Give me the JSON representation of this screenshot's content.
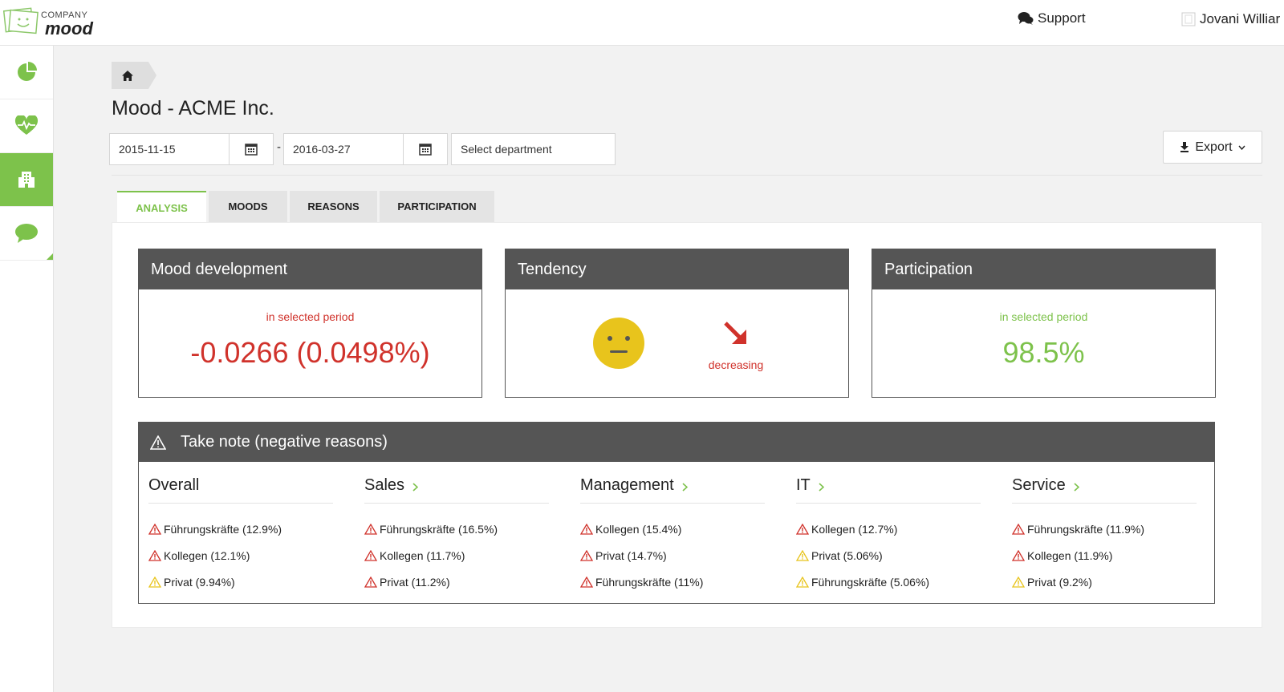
{
  "header": {
    "logo_top": "COMPANY",
    "logo_bottom": "mood",
    "support_label": "Support",
    "user_name": "Jovani Williar"
  },
  "sidebar": {
    "items": [
      {
        "name": "dashboard",
        "icon": "pie-chart-icon",
        "active": false
      },
      {
        "name": "mood",
        "icon": "heartbeat-icon",
        "active": false
      },
      {
        "name": "organization",
        "icon": "building-icon",
        "active": true
      },
      {
        "name": "comments",
        "icon": "speech-bubble-icon",
        "active": false
      }
    ]
  },
  "page": {
    "title": "Mood - ACME Inc.",
    "breadcrumb_icon": "home-icon"
  },
  "filters": {
    "start_date": "2015-11-15",
    "separator": "-",
    "end_date": "2016-03-27",
    "department_placeholder": "Select department",
    "export_label": "Export"
  },
  "tabs": [
    {
      "label": "ANALYSIS",
      "active": true
    },
    {
      "label": "MOODS",
      "active": false
    },
    {
      "label": "REASONS",
      "active": false
    },
    {
      "label": "PARTICIPATION",
      "active": false
    }
  ],
  "cards": {
    "mood_development": {
      "title": "Mood development",
      "sub": "in selected period",
      "value": "-0.0266 (0.0498%)"
    },
    "tendency": {
      "title": "Tendency",
      "label": "decreasing"
    },
    "participation": {
      "title": "Participation",
      "sub": "in selected period",
      "value": "98.5%"
    }
  },
  "take_note": {
    "title": "Take note (negative reasons)",
    "columns": [
      {
        "title": "Overall",
        "link": false,
        "reasons": [
          {
            "text": "Führungskräfte (12.9%)",
            "level": "red"
          },
          {
            "text": "Kollegen (12.1%)",
            "level": "red"
          },
          {
            "text": "Privat (9.94%)",
            "level": "yellow"
          }
        ]
      },
      {
        "title": "Sales",
        "link": true,
        "reasons": [
          {
            "text": "Führungskräfte (16.5%)",
            "level": "red"
          },
          {
            "text": "Kollegen (11.7%)",
            "level": "red"
          },
          {
            "text": "Privat (11.2%)",
            "level": "red"
          }
        ]
      },
      {
        "title": "Management",
        "link": true,
        "reasons": [
          {
            "text": "Kollegen (15.4%)",
            "level": "red"
          },
          {
            "text": "Privat (14.7%)",
            "level": "red"
          },
          {
            "text": "Führungskräfte (11%)",
            "level": "red"
          }
        ]
      },
      {
        "title": "IT",
        "link": true,
        "reasons": [
          {
            "text": "Kollegen (12.7%)",
            "level": "red"
          },
          {
            "text": "Privat (5.06%)",
            "level": "yellow"
          },
          {
            "text": "Führungskräfte (5.06%)",
            "level": "yellow"
          }
        ]
      },
      {
        "title": "Service",
        "link": true,
        "reasons": [
          {
            "text": "Führungskräfte (11.9%)",
            "level": "red"
          },
          {
            "text": "Kollegen (11.9%)",
            "level": "red"
          },
          {
            "text": "Privat (9.2%)",
            "level": "yellow"
          }
        ]
      }
    ]
  },
  "colors": {
    "accent_green": "#7dc24b",
    "negative_red": "#d0322b",
    "warning_yellow": "#e8c41c",
    "header_dark": "#555555"
  }
}
